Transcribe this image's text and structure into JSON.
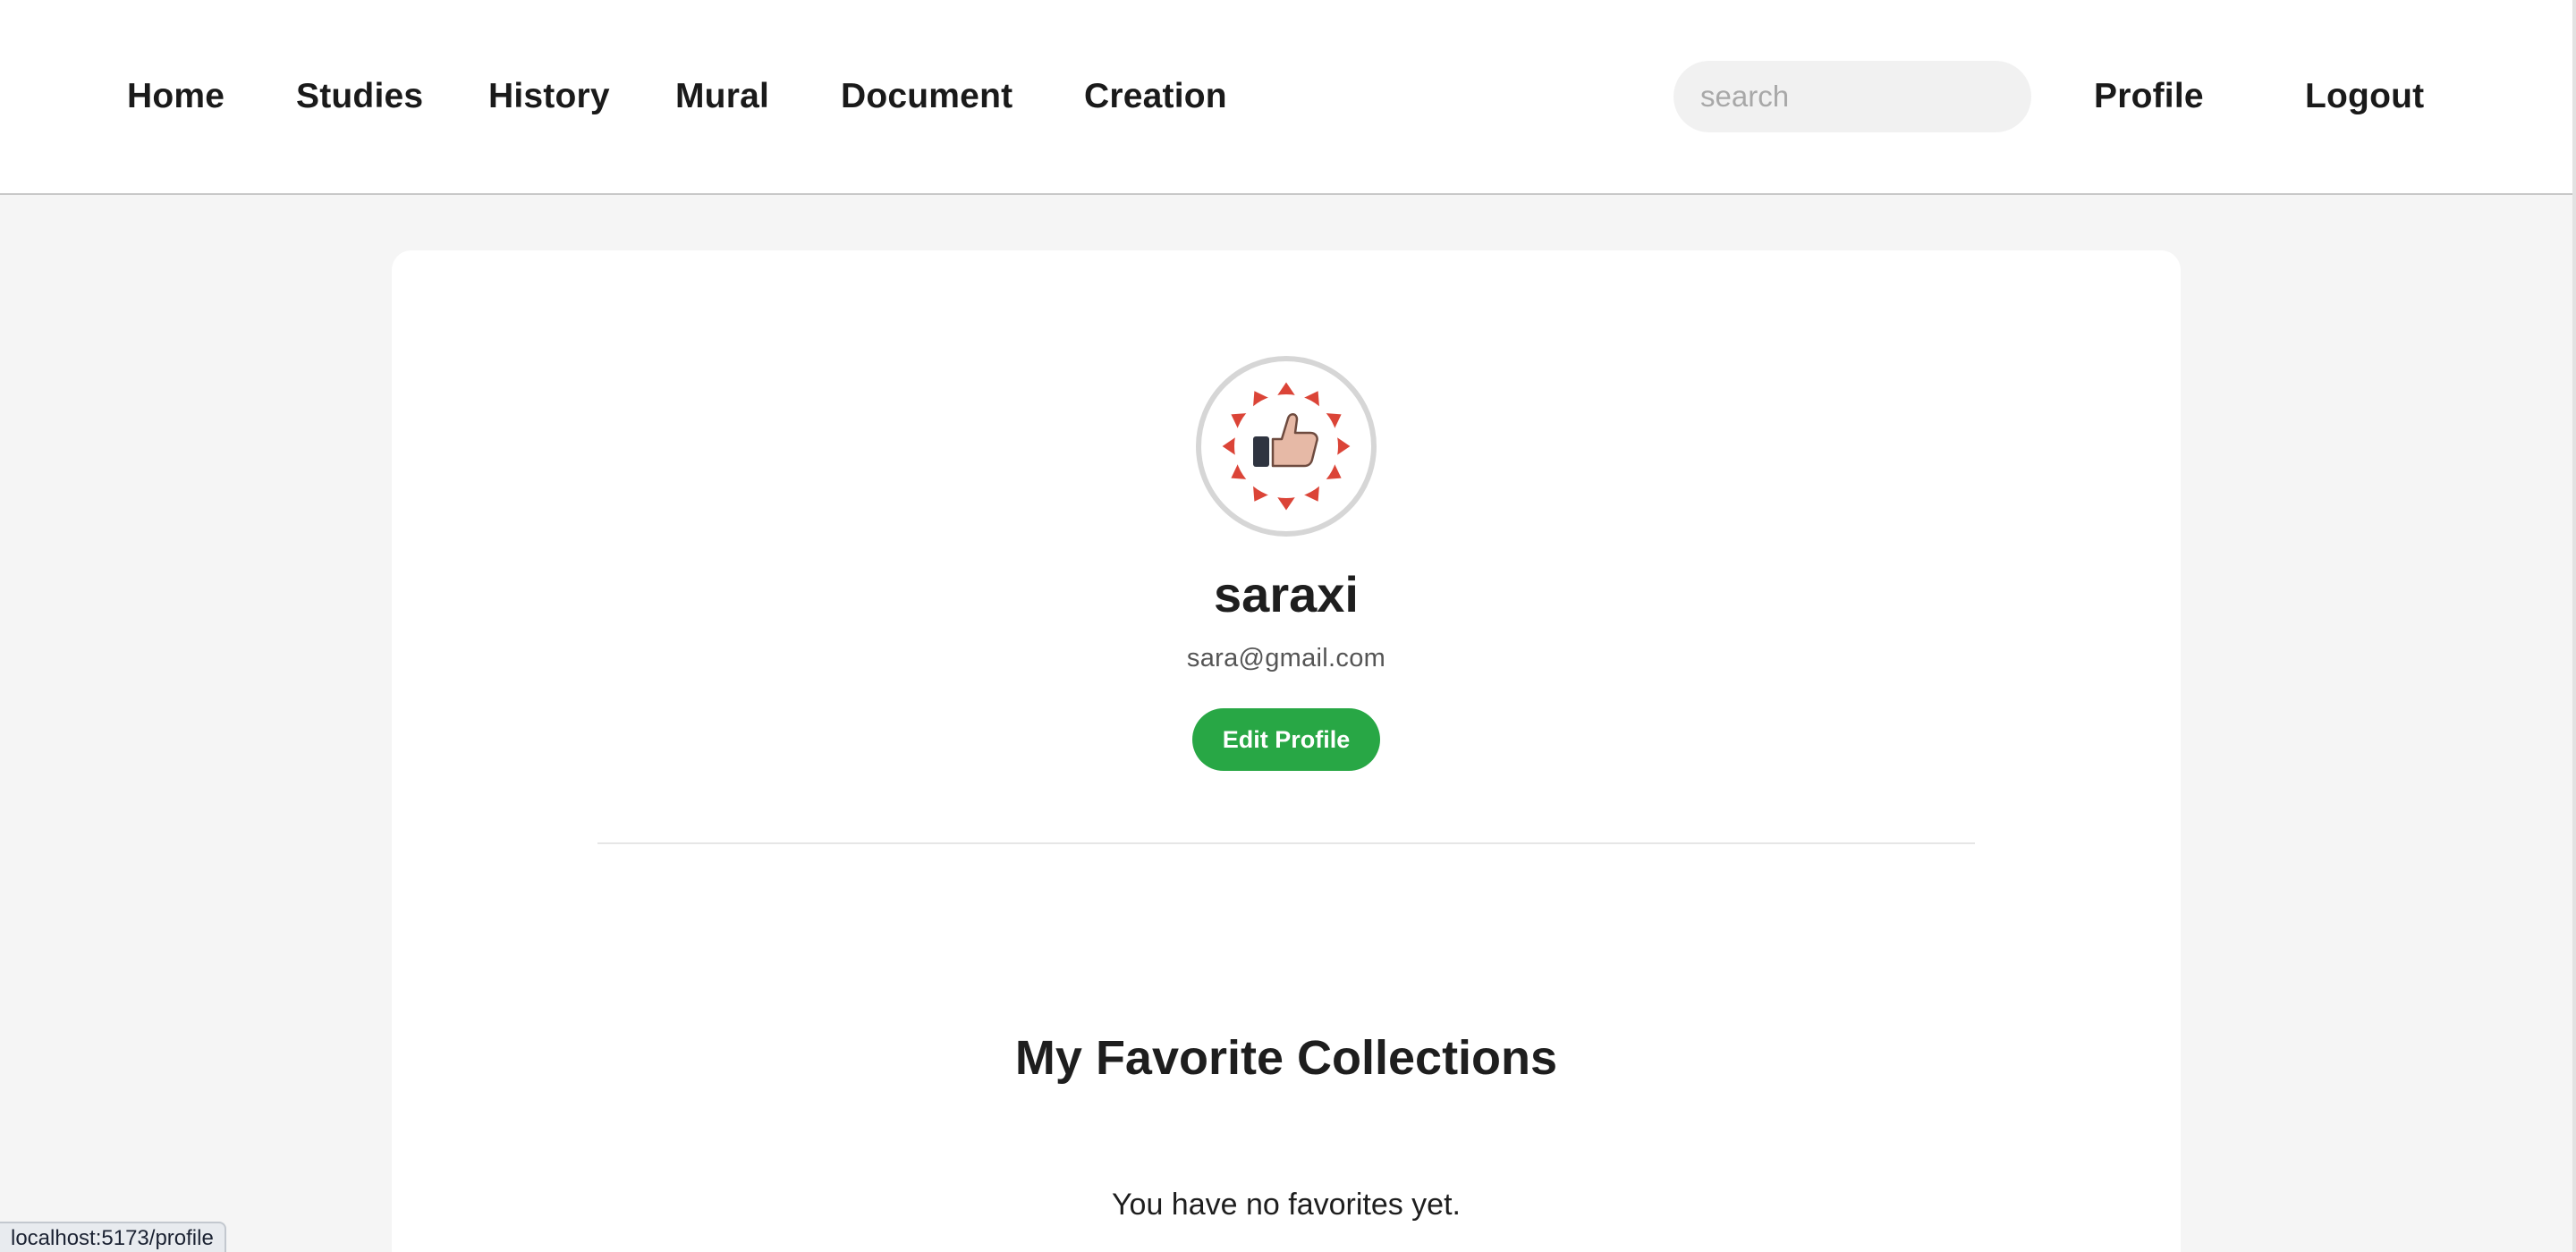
{
  "nav": {
    "links": [
      "Home",
      "Studies",
      "History",
      "Mural",
      "Document",
      "Creation"
    ],
    "search_placeholder": "search",
    "profile_label": "Profile",
    "logout_label": "Logout"
  },
  "profile": {
    "username": "saraxi",
    "email": "sara@gmail.com",
    "edit_button_label": "Edit Profile",
    "avatar_icon": "thumbs-up-badge-icon"
  },
  "favorites": {
    "title": "My Favorite Collections",
    "empty_message": "You have no favorites yet."
  },
  "status_bar": {
    "url": "localhost:5173/profile"
  },
  "colors": {
    "accent_green": "#28a745",
    "badge_red": "#db4437",
    "page_background": "#f5f5f5"
  }
}
